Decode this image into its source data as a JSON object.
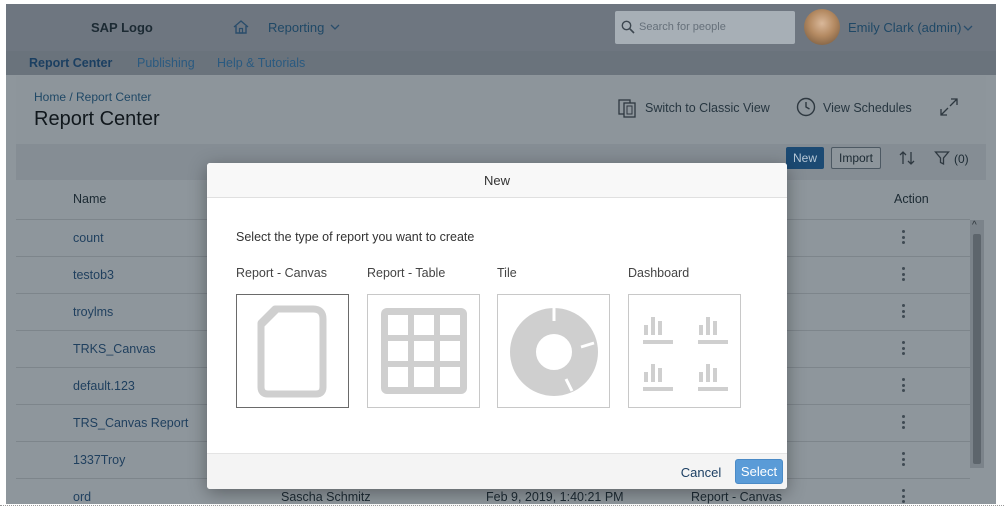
{
  "shellbar": {
    "logo": "SAP Logo",
    "menu_label": "Reporting",
    "search_placeholder": "Search for people",
    "user_name": "Emily Clark (admin)"
  },
  "tabs": [
    {
      "label": "Report Center",
      "active": true
    },
    {
      "label": "Publishing",
      "active": false
    },
    {
      "label": "Help & Tutorials",
      "active": false
    }
  ],
  "header": {
    "breadcrumb": "Home / Report Center",
    "title": "Report Center",
    "switch_view": "Switch to Classic View",
    "view_schedules": "View Schedules"
  },
  "toolbar": {
    "new_label": "New",
    "import_label": "Import",
    "filter_count": "(0)"
  },
  "table": {
    "headers": {
      "name": "Name",
      "action": "Action"
    },
    "rows": [
      {
        "name": "count"
      },
      {
        "name": "testob3"
      },
      {
        "name": "troylms"
      },
      {
        "name": "TRKS_Canvas"
      },
      {
        "name": "default.123"
      },
      {
        "name": "TRS_Canvas Report"
      },
      {
        "name": "1337Troy"
      },
      {
        "name": "ord",
        "owner": "Sascha Schmitz",
        "modified": "Feb 9, 2019, 1:40:21 PM",
        "type": "Report - Canvas"
      }
    ]
  },
  "dialog": {
    "title": "New",
    "prompt": "Select the type of report you want to create",
    "options": [
      {
        "label": "Report - Canvas",
        "icon": "document-icon",
        "selected": true
      },
      {
        "label": "Report - Table",
        "icon": "table-grid-icon",
        "selected": false
      },
      {
        "label": "Tile",
        "icon": "donut-chart-icon",
        "selected": false
      },
      {
        "label": "Dashboard",
        "icon": "dashboard-bars-icon",
        "selected": false
      }
    ],
    "cancel_label": "Cancel",
    "select_label": "Select"
  },
  "colors": {
    "accent": "#5a9bd7",
    "icon_gray": "#cfcfcf"
  }
}
